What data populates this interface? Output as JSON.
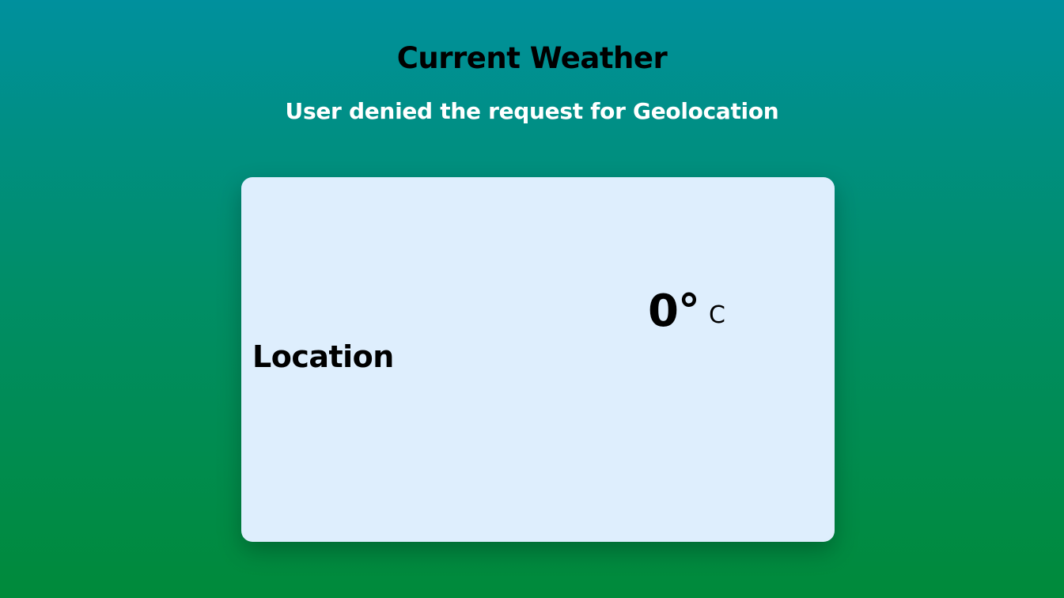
{
  "header": {
    "title": "Current Weather",
    "status_message": "User denied the request for Geolocation"
  },
  "card": {
    "location": "Location",
    "temperature": "0°",
    "unit": "C"
  },
  "colors": {
    "background_top": "#00909d",
    "background_bottom": "#008a3a",
    "card_background": "#deeefd",
    "title_text": "#000000",
    "status_text": "#ffffff"
  }
}
